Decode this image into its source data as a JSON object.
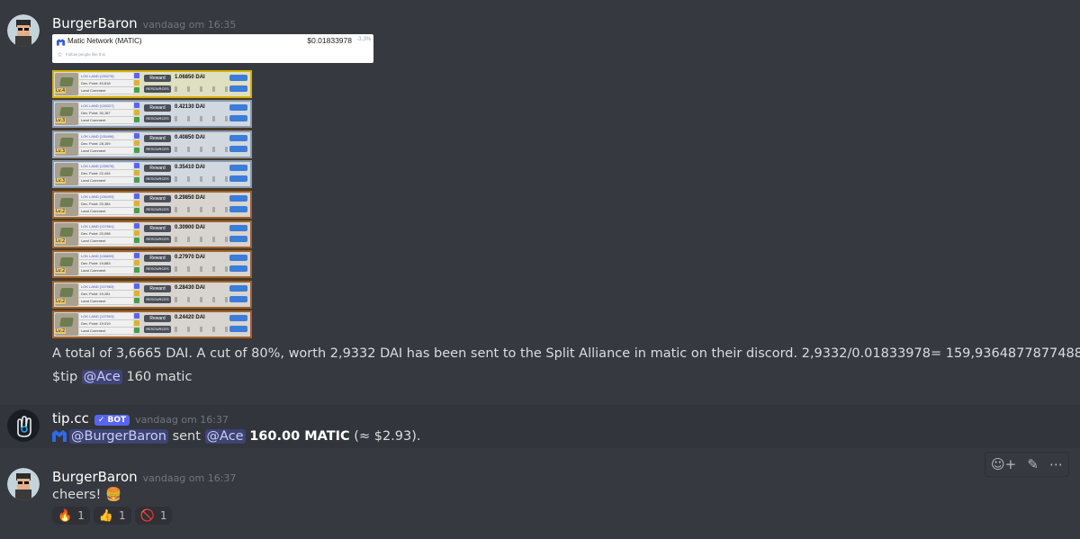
{
  "messages": {
    "m1": {
      "username": "BurgerBaron",
      "timestamp": "vandaag om 16:35",
      "embed": {
        "coin_name": "Matic Network (MATIC)",
        "price": "$0.01833978",
        "change": "-3.3%",
        "follow_text": "Follow people like this"
      },
      "lands": [
        {
          "tier": "gold",
          "name": "LOK LAND [135278]",
          "dev": "Dev. Point: 40,818",
          "comment": "Land Comment",
          "level": "Lv.4",
          "dai": "1.06850 DAI"
        },
        {
          "tier": "silver",
          "name": "LOK LAND [135327]",
          "dev": "Dev. Point: 30,187",
          "comment": "Land Comment",
          "level": "Lv.3",
          "dai": "0.42130 DAI"
        },
        {
          "tier": "silver",
          "name": "LOK LAND [135496]",
          "dev": "Dev. Point: 28,159",
          "comment": "Land Comment",
          "level": "Lv.3",
          "dai": "0.40850 DAI"
        },
        {
          "tier": "silver",
          "name": "LOK LAND [135578]",
          "dev": "Dev. Point: 22,444",
          "comment": "Land Comment",
          "level": "Lv.3",
          "dai": "0.35410 DAI"
        },
        {
          "tier": "bronze",
          "name": "LOK LAND [136493]",
          "dev": "Dev. Point: 20,384",
          "comment": "Land Comment",
          "level": "Lv.2",
          "dai": "0.29850 DAI"
        },
        {
          "tier": "bronze",
          "name": "LOK LAND [137561]",
          "dev": "Dev. Point: 20,098",
          "comment": "Land Comment",
          "level": "Lv.2",
          "dai": "0.30900 DAI"
        },
        {
          "tier": "bronze",
          "name": "LOK LAND [136693]",
          "dev": "Dev. Point: 19,883",
          "comment": "Land Comment",
          "level": "Lv.2",
          "dai": "0.27970 DAI"
        },
        {
          "tier": "bronze",
          "name": "LOK LAND [137983]",
          "dev": "Dev. Point: 19,281",
          "comment": "Land Comment",
          "level": "Lv.2",
          "dai": "0.28430 DAI"
        },
        {
          "tier": "bronze",
          "name": "LOK LAND [137503]",
          "dev": "Dev. Point: 19,019",
          "comment": "Land Comment",
          "level": "Lv.2",
          "dai": "0.24420 DAI"
        }
      ],
      "reward_label": "Reward",
      "resources_label": "RESOURCES",
      "text1": "A total of 3,6665 DAI. A cut of 80%, worth 2,9332 DAI has been sent to the Split Alliance in matic on their discord.  2,9332/0.01833978= 159,9364877877488",
      "tip_prefix": "$tip",
      "tip_mention": "@Ace",
      "tip_amount": "160 matic"
    },
    "m2": {
      "username": "tip.cc",
      "bot_tag": "✓ BOT",
      "timestamp": "vandaag om 16:37",
      "sender_mention": "@BurgerBaron",
      "sent_word": "sent",
      "recipient_mention": "@Ace",
      "amount": "160.00 MATIC",
      "usd": "(≈ $2.93)."
    },
    "m3": {
      "username": "BurgerBaron",
      "timestamp": "vandaag om 16:37",
      "text": "cheers!",
      "emoji": "🍔",
      "reactions": [
        {
          "emoji": "🔥",
          "count": "1"
        },
        {
          "emoji": "👍",
          "count": "1"
        },
        {
          "emoji": "🚫",
          "count": "1"
        }
      ]
    }
  },
  "hover_actions": {
    "add_reaction": "☺+",
    "edit": "✎",
    "more": "⋯"
  }
}
